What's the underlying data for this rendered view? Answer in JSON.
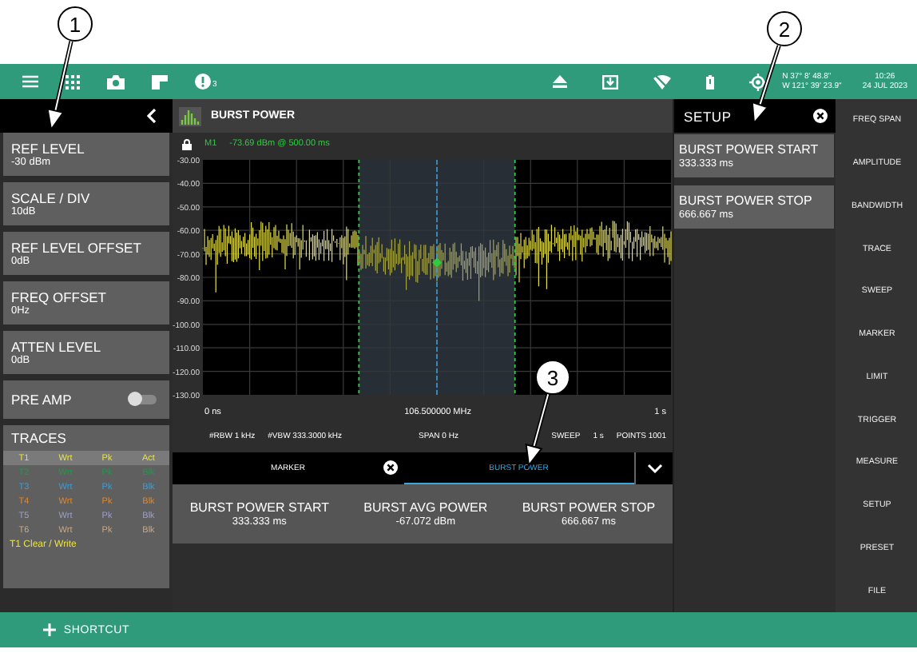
{
  "top_bar": {
    "alert_count": "3",
    "gps_latitude": "N 37° 8' 48.8\"",
    "gps_longitude": "W 121° 39' 23.9\"",
    "time": "10:26",
    "date": "24 JUL 2023"
  },
  "left_panel": {
    "params": [
      {
        "kind": "param",
        "label": "REF LEVEL",
        "value": "-30 dBm"
      },
      {
        "kind": "param",
        "label": "SCALE / DIV",
        "value": "10dB"
      },
      {
        "kind": "param",
        "label": "REF LEVEL OFFSET",
        "value": "0dB"
      },
      {
        "kind": "param",
        "label": "FREQ OFFSET",
        "value": "0Hz"
      },
      {
        "kind": "param",
        "label": "ATTEN LEVEL",
        "value": "0dB"
      },
      {
        "kind": "toggle",
        "label": "PRE AMP",
        "on": false
      }
    ],
    "traces": {
      "title": "TRACES",
      "rows": [
        {
          "name": "T1",
          "mode": "Wrt",
          "detector": "Pk",
          "state": "Act",
          "color": "#e8e24a",
          "selected": true
        },
        {
          "name": "T2",
          "mode": "Wrt",
          "detector": "Pk",
          "state": "Blk",
          "color": "#1f9a4a",
          "selected": false
        },
        {
          "name": "T3",
          "mode": "Wrt",
          "detector": "Pk",
          "state": "Blk",
          "color": "#3a9ed8",
          "selected": false
        },
        {
          "name": "T4",
          "mode": "Wrt",
          "detector": "Pk",
          "state": "Blk",
          "color": "#e0882a",
          "selected": false
        },
        {
          "name": "T5",
          "mode": "Wrt",
          "detector": "Pk",
          "state": "Blk",
          "color": "#9aa0c8",
          "selected": false
        },
        {
          "name": "T6",
          "mode": "Wrt",
          "detector": "Pk",
          "state": "Blk",
          "color": "#c8a888",
          "selected": false
        }
      ],
      "footer": "T1 Clear / Write"
    }
  },
  "chart_panel": {
    "title": "BURST POWER",
    "marker_label": "M1",
    "marker_reading": "-73.69 dBm @ 500.00 ms",
    "y_labels": [
      "-30.00",
      "-40.00",
      "-50.00",
      "-60.00",
      "-70.00",
      "-80.00",
      "-90.00",
      "-100.00",
      "-110.00",
      "-120.00",
      "-130.00"
    ],
    "x_start": "0 ns",
    "x_center": "106.500000 MHz",
    "x_stop": "1 s",
    "settings": [
      "#RBW 1 kHz",
      "#VBW 333.3000 kHz",
      "SPAN 0 Hz",
      "SWEEP",
      "1 s",
      "POINTS 1001"
    ],
    "tabs": [
      {
        "label": "MARKER",
        "closable": true,
        "selected": false
      },
      {
        "label": "BURST POWER",
        "closable": false,
        "selected": true
      }
    ],
    "results": [
      {
        "label": "BURST POWER START",
        "value": "333.333 ms"
      },
      {
        "label": "BURST AVG POWER",
        "value": "-67.072 dBm"
      },
      {
        "label": "BURST POWER STOP",
        "value": "666.667 ms"
      }
    ]
  },
  "setup_panel": {
    "title": "SETUP",
    "items": [
      {
        "label": "BURST POWER START",
        "value": "333.333 ms"
      },
      {
        "label": "BURST POWER STOP",
        "value": "666.667 ms"
      }
    ]
  },
  "side_menu": [
    "FREQ SPAN",
    "AMPLITUDE",
    "BANDWIDTH",
    "TRACE",
    "SWEEP",
    "MARKER",
    "LIMIT",
    "TRIGGER",
    "MEASURE",
    "SETUP",
    "PRESET",
    "FILE"
  ],
  "bottom_bar": {
    "shortcut": "SHORTCUT"
  },
  "callouts": [
    "1",
    "2",
    "3"
  ]
}
